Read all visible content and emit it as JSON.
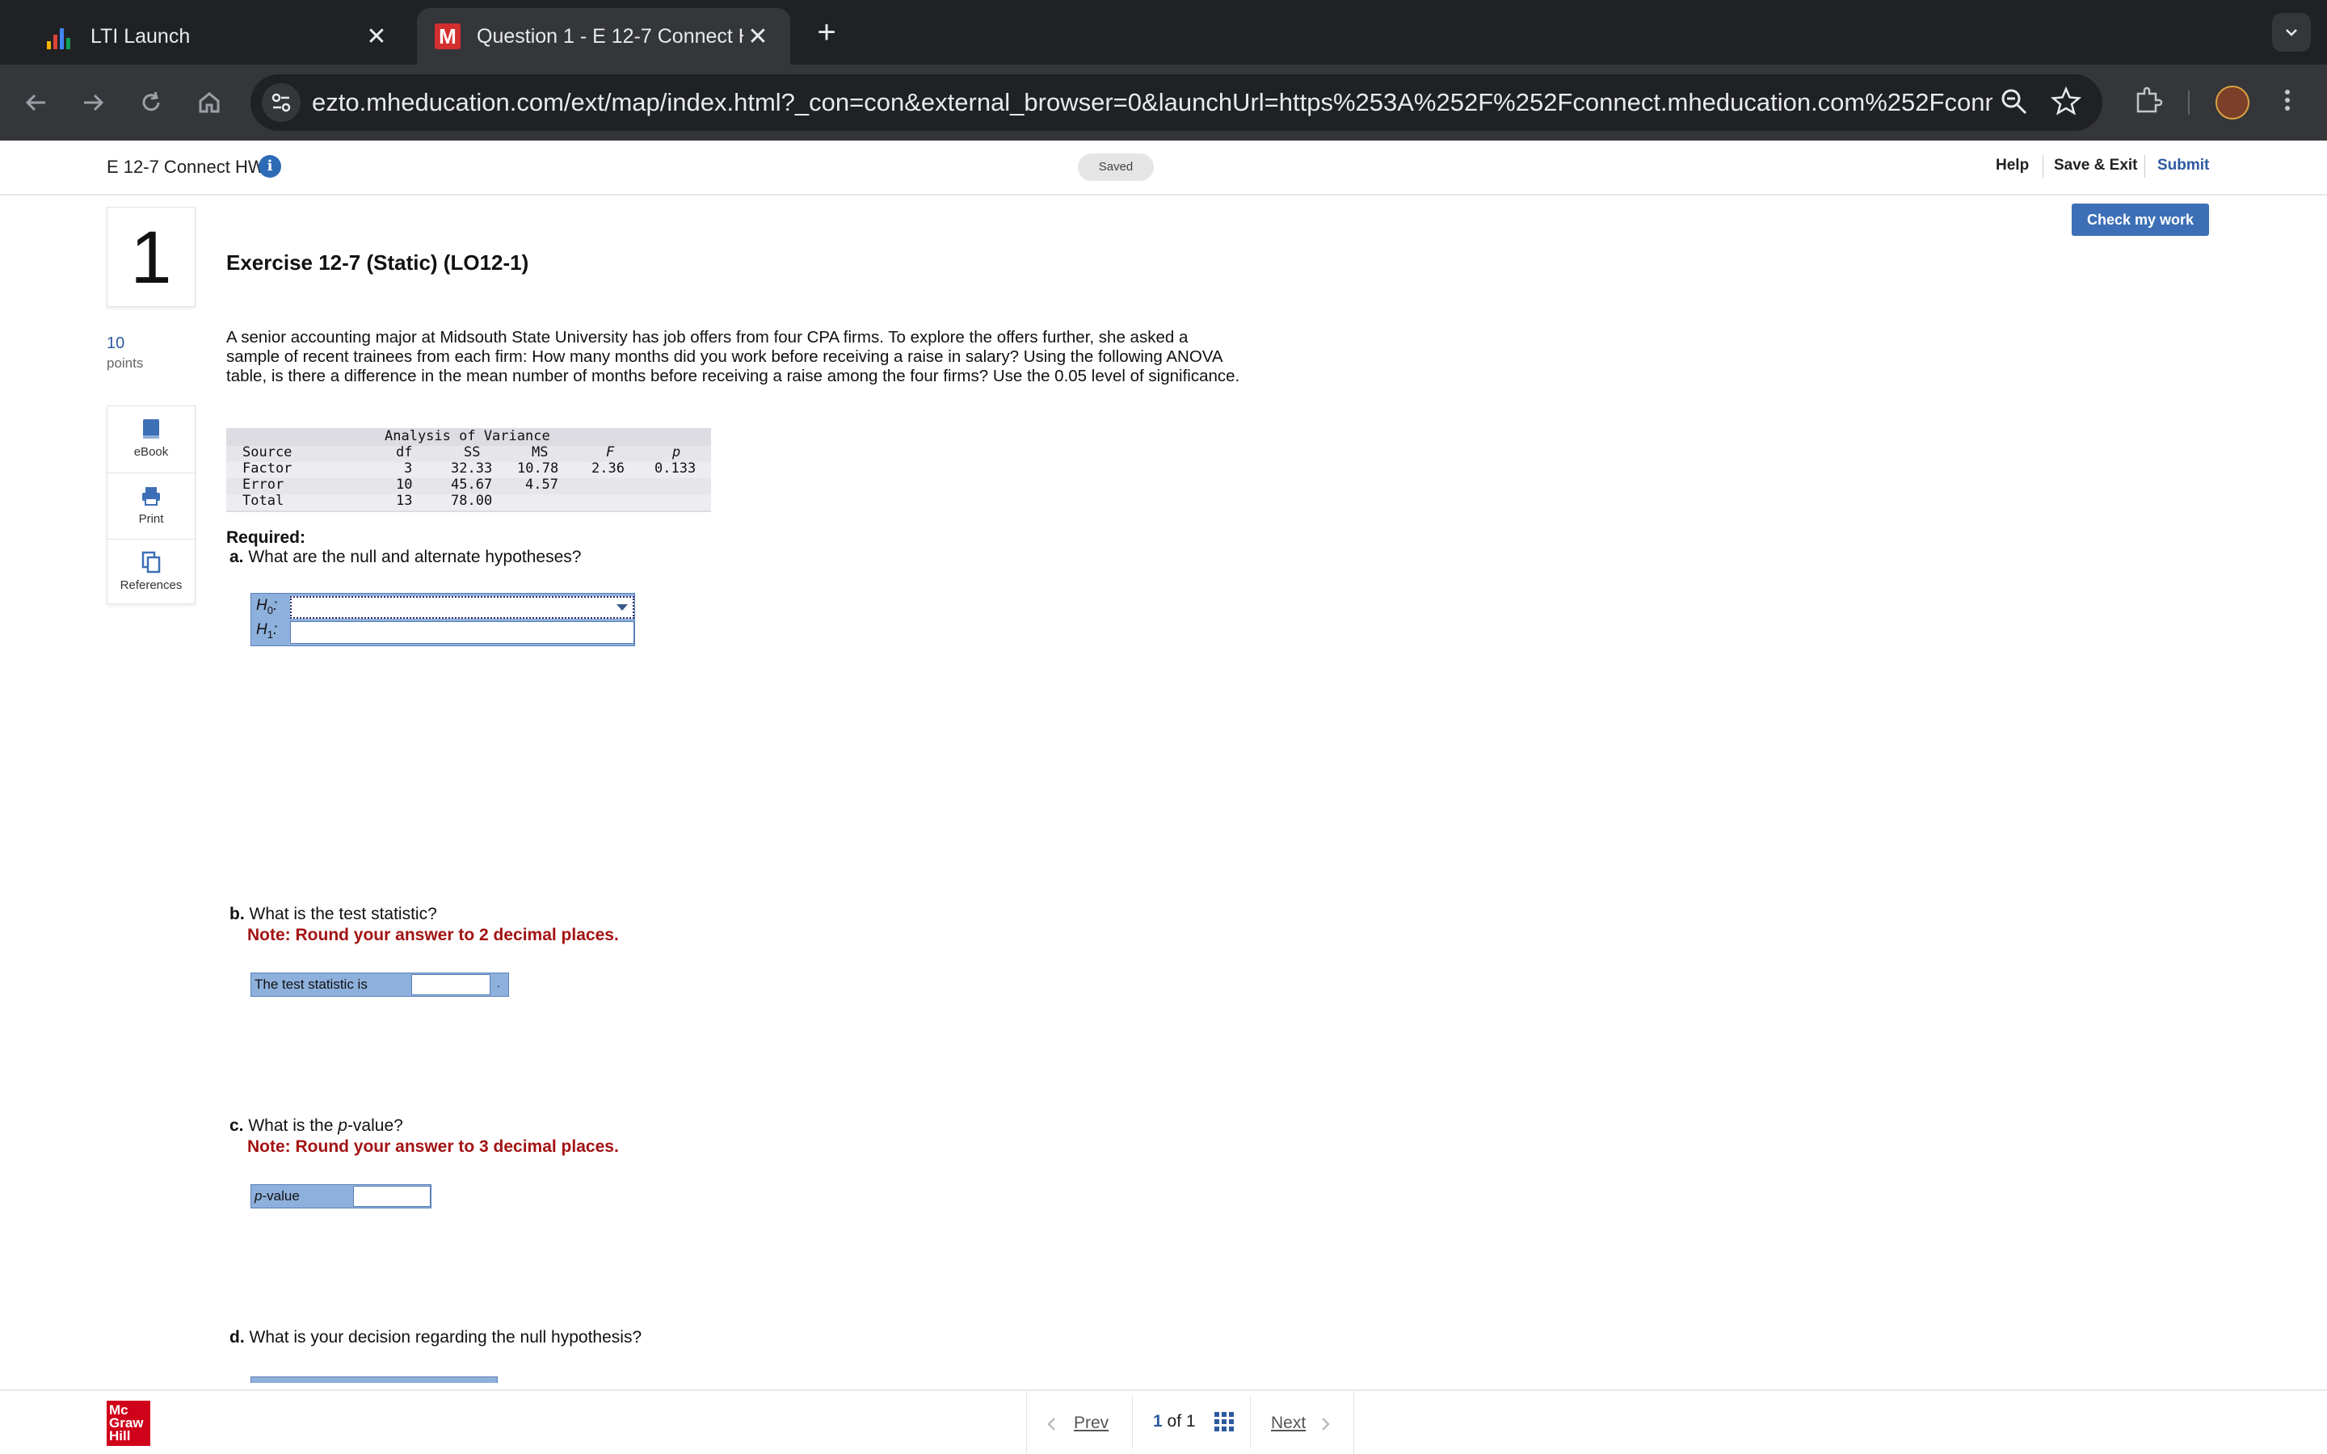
{
  "browser": {
    "tabs": [
      {
        "title": "LTI Launch",
        "close": "✕"
      },
      {
        "title": "Question 1 - E 12-7 Connect H",
        "close": "✕"
      }
    ],
    "new_tab": "+",
    "url": "ezto.mheducation.com/ext/map/index.html?_con=con&external_browser=0&launchUrl=https%253A%252F%252Fconnect.mheducation.com%252Fconnec..."
  },
  "header": {
    "assignment_title": "E 12-7 Connect HW",
    "saved": "Saved",
    "help": "Help",
    "save_exit": "Save & Exit",
    "submit": "Submit"
  },
  "rail": {
    "question_number": "1",
    "points_value": "10",
    "points_label": "points",
    "tools": [
      "eBook",
      "Print",
      "References"
    ]
  },
  "main": {
    "check_button": "Check my work",
    "exercise_title": "Exercise 12-7 (Static) (LO12-1)",
    "problem_text": "A senior accounting major at Midsouth State University has job offers from four CPA firms. To explore the offers further, she asked a sample of recent trainees from each firm: How many months did you work before receiving a raise in salary? Using the following ANOVA table, is there a difference in the mean number of months before receiving a raise among the four firms? Use the 0.05 level of significance.",
    "anova": {
      "title": "Analysis of Variance",
      "headers": [
        "Source",
        "df",
        "SS",
        "MS",
        "F",
        "p"
      ],
      "rows": [
        [
          "Factor",
          "3",
          "32.33",
          "10.78",
          "2.36",
          "0.133"
        ],
        [
          "Error",
          "10",
          "45.67",
          "4.57",
          "",
          ""
        ],
        [
          "Total",
          "13",
          "78.00",
          "",
          "",
          ""
        ]
      ]
    },
    "required": "Required:",
    "qa_letter": "a.",
    "qa_text": "What are the null and alternate hypotheses?",
    "h0_label": "H",
    "h0_sub": "0",
    "h1_label": "H",
    "h1_sub": "1",
    "qb_letter": "b.",
    "qb_text": "What is the test statistic?",
    "qb_note": "Note: Round your answer to 2 decimal places.",
    "qb_field_label": "The test statistic is",
    "qb_suffix": ".",
    "qc_letter": "c.",
    "qc_text_pre": "What is the ",
    "qc_text_em": "p",
    "qc_text_post": "-value?",
    "qc_note": "Note: Round your answer to 3 decimal places.",
    "qc_field_label_em": "p",
    "qc_field_label_post": "-value",
    "qd_letter": "d.",
    "qd_text": "What is your decision regarding the null hypothesis?"
  },
  "footer": {
    "logo_lines": [
      "Mc",
      "Graw",
      "Hill"
    ],
    "prev": "Prev",
    "current": "1",
    "of": "of",
    "total": "1",
    "next": "Next"
  }
}
